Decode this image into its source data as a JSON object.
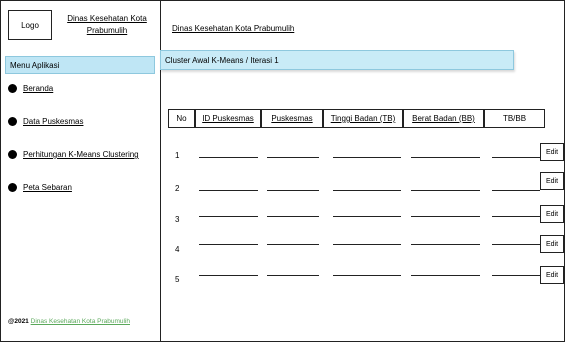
{
  "sidebar": {
    "logo_label": "Logo",
    "app_title": "Dinas Kesehatan Kota Prabumulih",
    "menu_title": "Menu Aplikasi",
    "items": [
      {
        "label": "Beranda"
      },
      {
        "label": "Data Puskesmas"
      },
      {
        "label": "Perhitungan K-Means Clustering"
      },
      {
        "label": "Peta Sebaran"
      }
    ],
    "footer_prefix": "@2021",
    "footer_link": "Dinas Kesehatan Kota Prabumulih"
  },
  "main": {
    "title": "Dinas Kesehatan Kota Prabumulih",
    "cluster_label": "Cluster Awal K-Means / Iterasi 1",
    "table": {
      "headers": [
        "No",
        "ID Puskesmas",
        "Puskesmas",
        "Tinggi Badan (TB)",
        "Berat Badan (BB)",
        "TB/BB"
      ],
      "rows": [
        "1",
        "2",
        "3",
        "4",
        "5"
      ],
      "edit_label": "Edit"
    }
  }
}
